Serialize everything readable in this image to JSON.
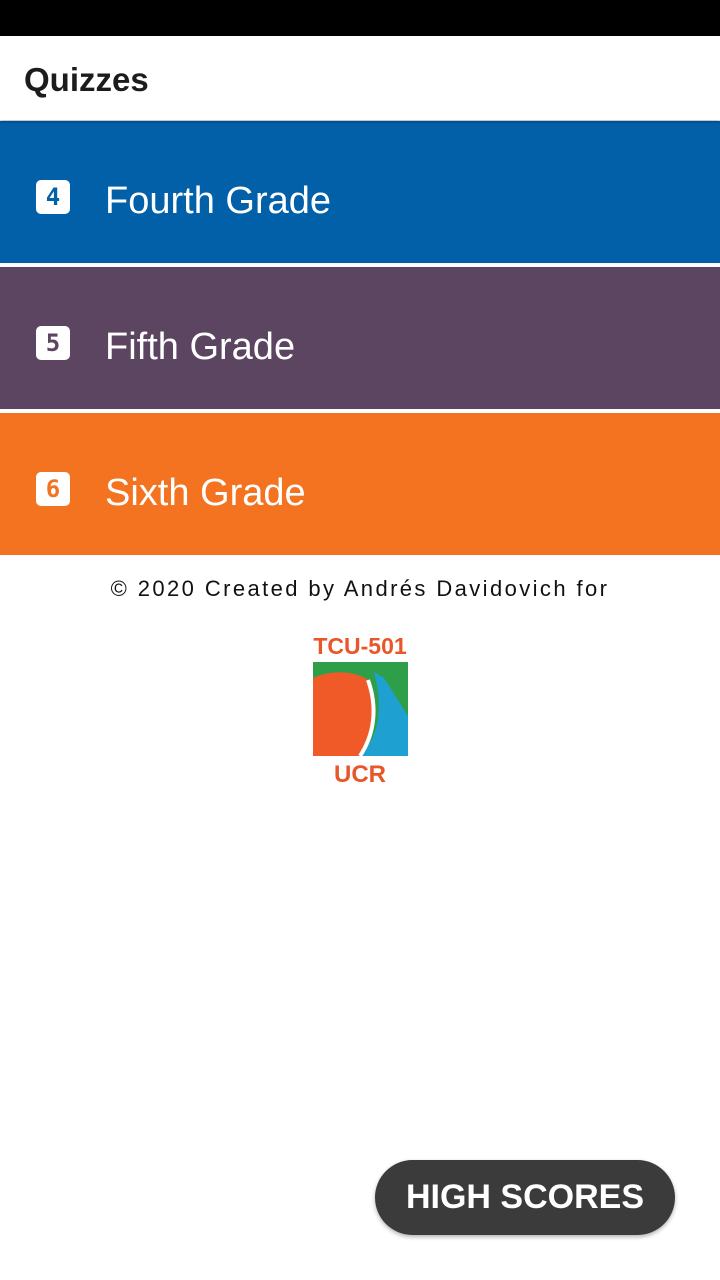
{
  "app_bar": {
    "title": "Quizzes"
  },
  "grades": [
    {
      "label": "Fourth Grade",
      "icon_number": "4",
      "icon": "number-4-icon",
      "color": "#0160A8"
    },
    {
      "label": "Fifth Grade",
      "icon_number": "5",
      "icon": "number-5-icon",
      "color": "#5C4560"
    },
    {
      "label": "Sixth Grade",
      "icon_number": "6",
      "icon": "number-6-icon",
      "color": "#F37321"
    }
  ],
  "footer": {
    "credit": "© 2020 Created by Andrés Davidovich for",
    "logo": {
      "top_text": "TCU-501",
      "bottom_text": "UCR",
      "colors": {
        "text": "#E8562A",
        "green": "#2E9F48",
        "orange": "#F05A28",
        "blue": "#1EA0D0"
      }
    }
  },
  "high_scores_button": {
    "label": "HIGH SCORES",
    "color": "#3B3B3B"
  }
}
